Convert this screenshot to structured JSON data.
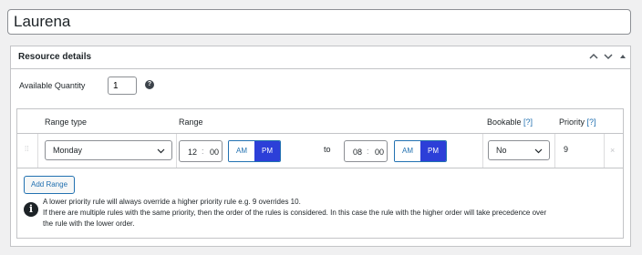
{
  "title": {
    "value": "Laurena"
  },
  "panel": {
    "title": "Resource details",
    "controls": {
      "up": "chevron-up",
      "down": "chevron-down",
      "toggle": "triangle-up"
    }
  },
  "quantity": {
    "label": "Available Quantity",
    "value": "1",
    "help_icon": "?"
  },
  "table": {
    "headers": {
      "range_type": "Range type",
      "range": "Range",
      "bookable": "Bookable",
      "bookable_help": "[?]",
      "priority": "Priority",
      "priority_help": "[?]"
    },
    "rows": [
      {
        "range_type": "Monday",
        "from_hh": "12",
        "from_mm": "00",
        "from_am": "AM",
        "from_pm": "PM",
        "to": "to",
        "to_hh": "08",
        "to_mm": "00",
        "to_am": "AM",
        "to_pm": "PM",
        "bookable": "No",
        "priority": "9",
        "remove": "×"
      }
    ]
  },
  "add_range_label": "Add Range",
  "notice": {
    "line1": "A lower priority rule will always override a higher priority rule e.g. 9 overrides 10.",
    "line2": "If there are multiple rules with the same priority, then the order of the rules is considered. In this case the rule with the higher order will take precedence over the rule with the lower order."
  },
  "colors": {
    "accent": "#2271b1",
    "active_toggle": "#2c3fd8",
    "border": "#c3c4c7"
  }
}
